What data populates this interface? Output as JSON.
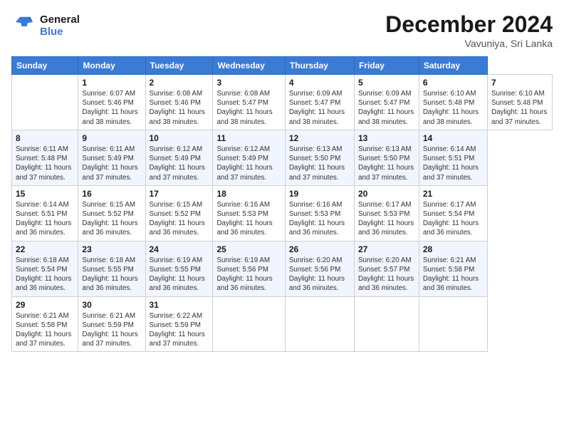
{
  "header": {
    "logo_line1": "General",
    "logo_line2": "Blue",
    "month_title": "December 2024",
    "location": "Vavuniya, Sri Lanka"
  },
  "calendar": {
    "headers": [
      "Sunday",
      "Monday",
      "Tuesday",
      "Wednesday",
      "Thursday",
      "Friday",
      "Saturday"
    ],
    "weeks": [
      [
        {
          "day": "",
          "info": ""
        },
        {
          "day": "1",
          "info": "Sunrise: 6:07 AM\nSunset: 5:46 PM\nDaylight: 11 hours\nand 38 minutes."
        },
        {
          "day": "2",
          "info": "Sunrise: 6:08 AM\nSunset: 5:46 PM\nDaylight: 11 hours\nand 38 minutes."
        },
        {
          "day": "3",
          "info": "Sunrise: 6:08 AM\nSunset: 5:47 PM\nDaylight: 11 hours\nand 38 minutes."
        },
        {
          "day": "4",
          "info": "Sunrise: 6:09 AM\nSunset: 5:47 PM\nDaylight: 11 hours\nand 38 minutes."
        },
        {
          "day": "5",
          "info": "Sunrise: 6:09 AM\nSunset: 5:47 PM\nDaylight: 11 hours\nand 38 minutes."
        },
        {
          "day": "6",
          "info": "Sunrise: 6:10 AM\nSunset: 5:48 PM\nDaylight: 11 hours\nand 38 minutes."
        },
        {
          "day": "7",
          "info": "Sunrise: 6:10 AM\nSunset: 5:48 PM\nDaylight: 11 hours\nand 37 minutes."
        }
      ],
      [
        {
          "day": "8",
          "info": "Sunrise: 6:11 AM\nSunset: 5:48 PM\nDaylight: 11 hours\nand 37 minutes."
        },
        {
          "day": "9",
          "info": "Sunrise: 6:11 AM\nSunset: 5:49 PM\nDaylight: 11 hours\nand 37 minutes."
        },
        {
          "day": "10",
          "info": "Sunrise: 6:12 AM\nSunset: 5:49 PM\nDaylight: 11 hours\nand 37 minutes."
        },
        {
          "day": "11",
          "info": "Sunrise: 6:12 AM\nSunset: 5:49 PM\nDaylight: 11 hours\nand 37 minutes."
        },
        {
          "day": "12",
          "info": "Sunrise: 6:13 AM\nSunset: 5:50 PM\nDaylight: 11 hours\nand 37 minutes."
        },
        {
          "day": "13",
          "info": "Sunrise: 6:13 AM\nSunset: 5:50 PM\nDaylight: 11 hours\nand 37 minutes."
        },
        {
          "day": "14",
          "info": "Sunrise: 6:14 AM\nSunset: 5:51 PM\nDaylight: 11 hours\nand 37 minutes."
        }
      ],
      [
        {
          "day": "15",
          "info": "Sunrise: 6:14 AM\nSunset: 5:51 PM\nDaylight: 11 hours\nand 36 minutes."
        },
        {
          "day": "16",
          "info": "Sunrise: 6:15 AM\nSunset: 5:52 PM\nDaylight: 11 hours\nand 36 minutes."
        },
        {
          "day": "17",
          "info": "Sunrise: 6:15 AM\nSunset: 5:52 PM\nDaylight: 11 hours\nand 36 minutes."
        },
        {
          "day": "18",
          "info": "Sunrise: 6:16 AM\nSunset: 5:53 PM\nDaylight: 11 hours\nand 36 minutes."
        },
        {
          "day": "19",
          "info": "Sunrise: 6:16 AM\nSunset: 5:53 PM\nDaylight: 11 hours\nand 36 minutes."
        },
        {
          "day": "20",
          "info": "Sunrise: 6:17 AM\nSunset: 5:53 PM\nDaylight: 11 hours\nand 36 minutes."
        },
        {
          "day": "21",
          "info": "Sunrise: 6:17 AM\nSunset: 5:54 PM\nDaylight: 11 hours\nand 36 minutes."
        }
      ],
      [
        {
          "day": "22",
          "info": "Sunrise: 6:18 AM\nSunset: 5:54 PM\nDaylight: 11 hours\nand 36 minutes."
        },
        {
          "day": "23",
          "info": "Sunrise: 6:18 AM\nSunset: 5:55 PM\nDaylight: 11 hours\nand 36 minutes."
        },
        {
          "day": "24",
          "info": "Sunrise: 6:19 AM\nSunset: 5:55 PM\nDaylight: 11 hours\nand 36 minutes."
        },
        {
          "day": "25",
          "info": "Sunrise: 6:19 AM\nSunset: 5:56 PM\nDaylight: 11 hours\nand 36 minutes."
        },
        {
          "day": "26",
          "info": "Sunrise: 6:20 AM\nSunset: 5:56 PM\nDaylight: 11 hours\nand 36 minutes."
        },
        {
          "day": "27",
          "info": "Sunrise: 6:20 AM\nSunset: 5:57 PM\nDaylight: 11 hours\nand 36 minutes."
        },
        {
          "day": "28",
          "info": "Sunrise: 6:21 AM\nSunset: 5:58 PM\nDaylight: 11 hours\nand 36 minutes."
        }
      ],
      [
        {
          "day": "29",
          "info": "Sunrise: 6:21 AM\nSunset: 5:58 PM\nDaylight: 11 hours\nand 37 minutes."
        },
        {
          "day": "30",
          "info": "Sunrise: 6:21 AM\nSunset: 5:59 PM\nDaylight: 11 hours\nand 37 minutes."
        },
        {
          "day": "31",
          "info": "Sunrise: 6:22 AM\nSunset: 5:59 PM\nDaylight: 11 hours\nand 37 minutes."
        },
        {
          "day": "",
          "info": ""
        },
        {
          "day": "",
          "info": ""
        },
        {
          "day": "",
          "info": ""
        },
        {
          "day": "",
          "info": ""
        }
      ]
    ]
  }
}
